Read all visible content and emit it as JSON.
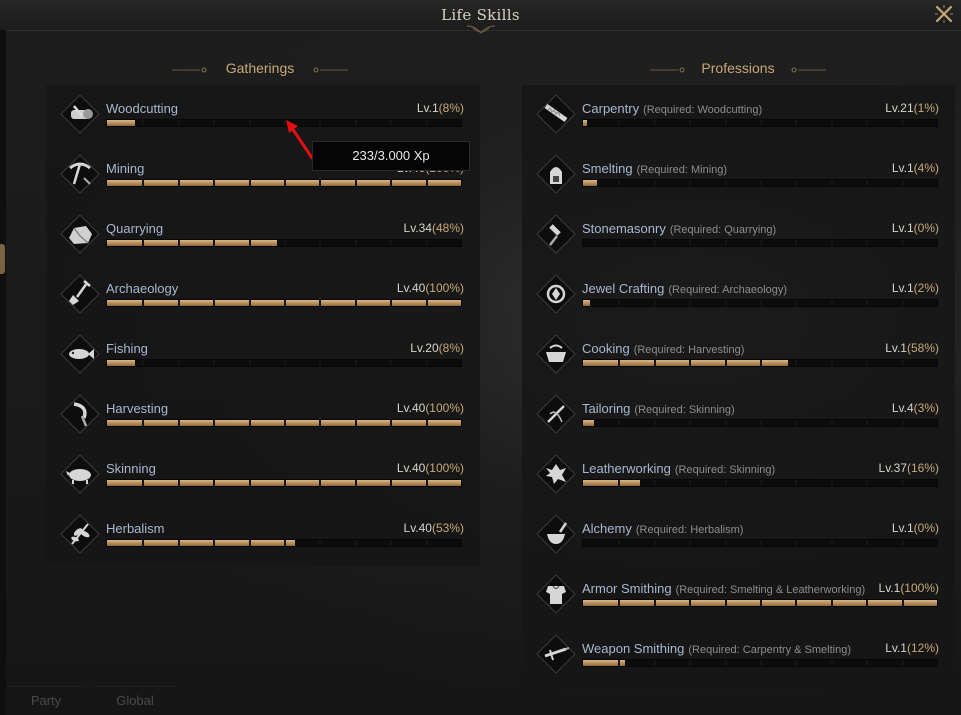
{
  "window": {
    "title": "Life Skills"
  },
  "tooltip": {
    "text": "233/3.000 Xp"
  },
  "gatherings": {
    "heading": "Gatherings",
    "items": [
      {
        "icon": "log-icon",
        "name": "Woodcutting",
        "req": "",
        "lv": "Lv.1",
        "pct": "(8%)",
        "progress": 0.08
      },
      {
        "icon": "pickaxe-icon",
        "name": "Mining",
        "req": "",
        "lv": "Lv.40",
        "pct": "(100%)",
        "progress": 1.0
      },
      {
        "icon": "stone-icon",
        "name": "Quarrying",
        "req": "",
        "lv": "Lv.34",
        "pct": "(48%)",
        "progress": 0.48
      },
      {
        "icon": "shovel-icon",
        "name": "Archaeology",
        "req": "",
        "lv": "Lv.40",
        "pct": "(100%)",
        "progress": 1.0
      },
      {
        "icon": "fish-icon",
        "name": "Fishing",
        "req": "",
        "lv": "Lv.20",
        "pct": "(8%)",
        "progress": 0.08
      },
      {
        "icon": "sickle-icon",
        "name": "Harvesting",
        "req": "",
        "lv": "Lv.40",
        "pct": "(100%)",
        "progress": 1.0
      },
      {
        "icon": "boar-icon",
        "name": "Skinning",
        "req": "",
        "lv": "Lv.40",
        "pct": "(100%)",
        "progress": 1.0
      },
      {
        "icon": "herb-icon",
        "name": "Herbalism",
        "req": "",
        "lv": "Lv.40",
        "pct": "(53%)",
        "progress": 0.53
      }
    ]
  },
  "professions": {
    "heading": "Professions",
    "items": [
      {
        "icon": "saw-icon",
        "name": "Carpentry",
        "req": "(Required: Woodcutting)",
        "lv": "Lv.21",
        "pct": "(1%)",
        "progress": 0.01
      },
      {
        "icon": "furnace-icon",
        "name": "Smelting",
        "req": "(Required: Mining)",
        "lv": "Lv.1",
        "pct": "(4%)",
        "progress": 0.04
      },
      {
        "icon": "chisel-icon",
        "name": "Stonemasonry",
        "req": "(Required: Quarrying)",
        "lv": "Lv.1",
        "pct": "(0%)",
        "progress": 0.0
      },
      {
        "icon": "gem-icon",
        "name": "Jewel Crafting",
        "req": "(Required: Archaeology)",
        "lv": "Lv.1",
        "pct": "(2%)",
        "progress": 0.02
      },
      {
        "icon": "pot-icon",
        "name": "Cooking",
        "req": "(Required: Harvesting)",
        "lv": "Lv.1",
        "pct": "(58%)",
        "progress": 0.58
      },
      {
        "icon": "needle-icon",
        "name": "Tailoring",
        "req": "(Required: Skinning)",
        "lv": "Lv.4",
        "pct": "(3%)",
        "progress": 0.03
      },
      {
        "icon": "leather-icon",
        "name": "Leatherworking",
        "req": "(Required: Skinning)",
        "lv": "Lv.37",
        "pct": "(16%)",
        "progress": 0.16
      },
      {
        "icon": "mortar-icon",
        "name": "Alchemy",
        "req": "(Required: Herbalism)",
        "lv": "Lv.1",
        "pct": "(0%)",
        "progress": 0.0
      },
      {
        "icon": "armor-icon",
        "name": "Armor Smithing",
        "req": "(Required: Smelting & Leatherworking)",
        "lv": "Lv.1",
        "pct": "(100%)",
        "progress": 1.0
      },
      {
        "icon": "sword-icon",
        "name": "Weapon Smithing",
        "req": "(Required: Carpentry & Smelting)",
        "lv": "Lv.1",
        "pct": "(12%)",
        "progress": 0.12
      }
    ]
  },
  "bottom_tabs": [
    "Party",
    "Global"
  ],
  "colors": {
    "accent": "#c8a878",
    "name": "#a8b8d0",
    "fill": "#c9a26c"
  }
}
